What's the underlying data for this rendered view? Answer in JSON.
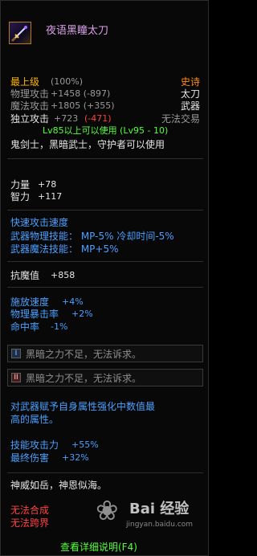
{
  "item": {
    "name": "夜语黑瞳太刀",
    "icon": "katana-icon"
  },
  "rarity": {
    "label": "最上级",
    "percent": "(100%)",
    "grade": "史诗"
  },
  "type": {
    "main": "太刀",
    "category": "武器",
    "trade": "无法交易"
  },
  "stats": {
    "physical_attack_label": "物理攻击",
    "physical_attack_value": "+1458 (-897)",
    "magic_attack_label": "魔法攻击",
    "magic_attack_value": "+1805 (+355)",
    "independent_attack_label": "独立攻击",
    "independent_attack_value": "+723",
    "independent_attack_diff": "(-471)"
  },
  "requirement": {
    "level": "Lv85以上可以使用 (Lv95 - 10)",
    "classes": "鬼剑士，黑暗武士，守护者可以使用"
  },
  "attributes": [
    {
      "label": "力量",
      "value": "+78"
    },
    {
      "label": "智力",
      "value": "+117"
    }
  ],
  "speed": {
    "title": "快速攻击速度",
    "phys_skill": "武器物理技能：  MP-5%  冷却时间-5%",
    "magic_skill": "武器魔法技能：  MP+5%"
  },
  "resist": {
    "label": "抗魔值",
    "value": "+858"
  },
  "buffs": [
    {
      "label": "施放速度",
      "value": "+4%"
    },
    {
      "label": "物理暴击率",
      "value": "+2%"
    },
    {
      "label": "命中率",
      "value": "-1%"
    }
  ],
  "slots": [
    {
      "badge": "I",
      "text": "黑暗之力不足，无法诉求。"
    },
    {
      "badge": "II",
      "text": "黑暗之力不足，无法诉求。"
    }
  ],
  "enchant": {
    "line1": "对武器赋予自身属性强化中数值最",
    "line2": "高的属性。"
  },
  "skill_bonus": [
    {
      "label": "技能攻击力",
      "value": "+55%"
    },
    {
      "label": "最终伤害",
      "value": "+32%"
    }
  ],
  "flavor": "神威如岳，神恩似海。",
  "restrictions": [
    "无法合成",
    "无法跨界"
  ],
  "footer": {
    "details": "查看详细说明(F4)"
  },
  "watermark": {
    "text": "Bai 经验",
    "sub": "jingyan.baidu.com"
  },
  "colors": {
    "gold": "#ffb400",
    "epic": "#ff8c18",
    "green": "#54ff3a",
    "blue": "#4aa0ff",
    "red": "#ff4040",
    "grey": "#9a9a9a"
  }
}
